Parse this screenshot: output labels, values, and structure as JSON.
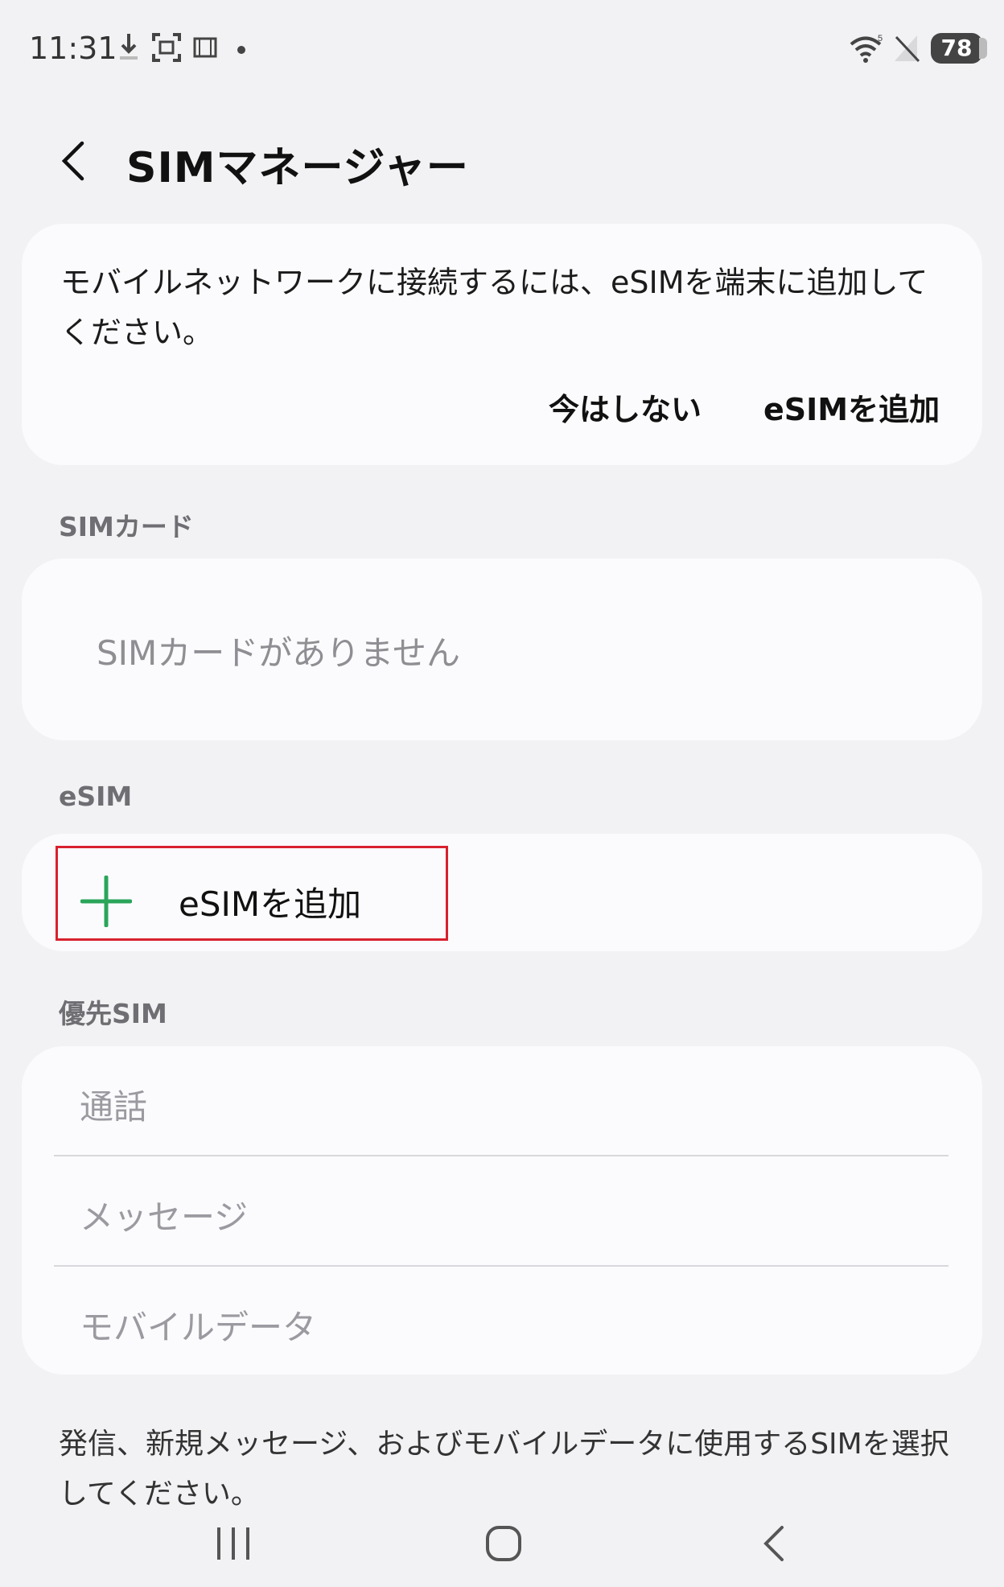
{
  "status_bar": {
    "time": "11:31",
    "battery": "78",
    "icons": [
      "download-icon",
      "screenshot-icon",
      "gallery-icon",
      "notification-dot-icon",
      "wifi-icon",
      "no-signal-icon",
      "battery-icon"
    ]
  },
  "header": {
    "title": "SIMマネージャー",
    "back_icon": "chevron-left-icon"
  },
  "info_card": {
    "message": "モバイルネットワークに接続するには、eSIMを端末に追加してください。",
    "dismiss_label": "今はしない",
    "add_label": "eSIMを追加"
  },
  "sim_section": {
    "label": "SIMカード",
    "empty_text": "SIMカードがありません"
  },
  "esim_section": {
    "label": "eSIM",
    "add_label": "eSIMを追加",
    "add_icon": "plus-icon",
    "accent_color": "#2aa55a",
    "highlight_color": "#d8212e"
  },
  "preferred_section": {
    "label": "優先SIM",
    "items": [
      {
        "label": "通話"
      },
      {
        "label": "メッセージ"
      },
      {
        "label": "モバイルデータ"
      }
    ]
  },
  "footer": {
    "text": "発信、新規メッセージ、およびモバイルデータに使用するSIMを選択してください。"
  },
  "nav_bar": {
    "icons": [
      "recent-apps-icon",
      "home-icon",
      "back-icon"
    ]
  }
}
